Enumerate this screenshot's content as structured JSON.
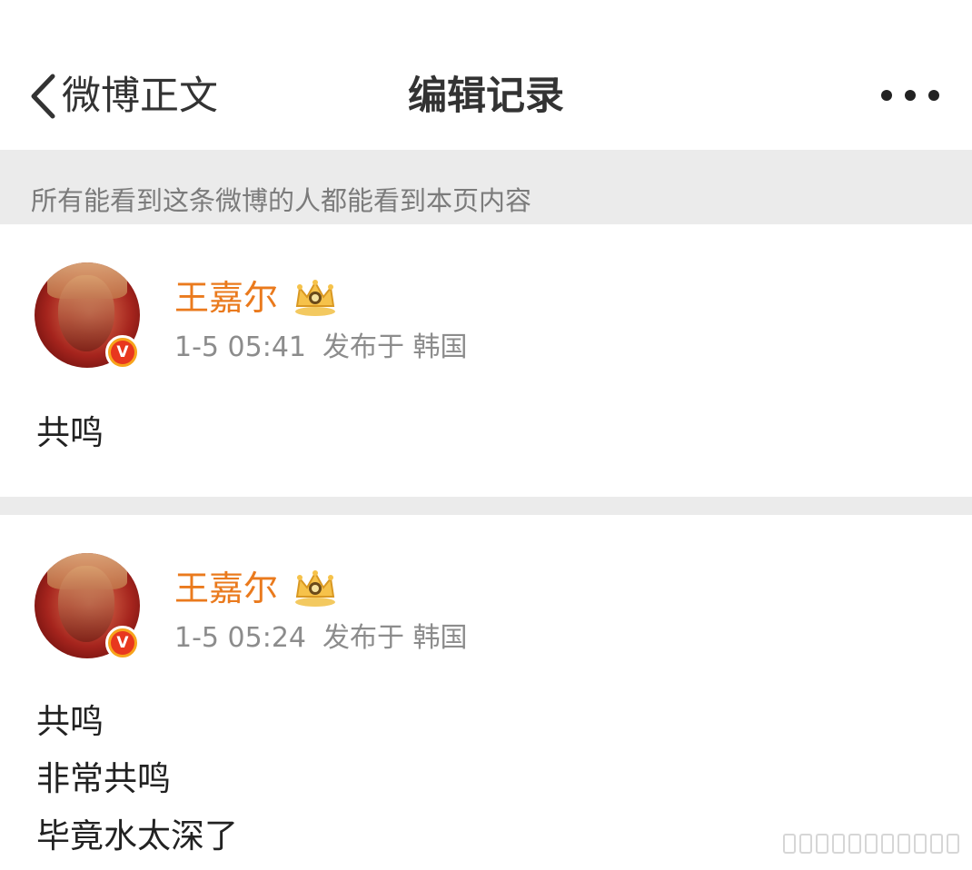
{
  "header": {
    "back_label": "微博正文",
    "title": "编辑记录",
    "more_icon": "more-dots-icon"
  },
  "notice": {
    "text": "所有能看到这条微博的人都能看到本页内容"
  },
  "records": [
    {
      "username": "王嘉尔",
      "time": "1-5 05:41",
      "published": "发布于 韩国",
      "verified_badge": "V",
      "lines": [
        "共鸣"
      ]
    },
    {
      "username": "王嘉尔",
      "time": "1-5 05:24",
      "published": "发布于 韩国",
      "verified_badge": "V",
      "lines": [
        "共鸣",
        "非常共鸣",
        "毕竟水太深了"
      ]
    }
  ],
  "colors": {
    "username": "#ea7a1d",
    "meta": "#8c8c8c",
    "separator": "#ebebeb",
    "badge_outer": "#f7a41c",
    "badge_inner": "#e8371e"
  }
}
